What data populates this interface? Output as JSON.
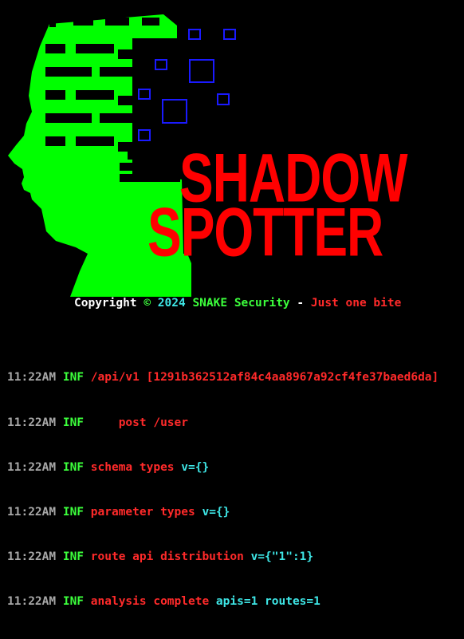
{
  "logo": {
    "title_line1": "SHADOW",
    "title_line2": "SPOTTER",
    "head_color": "#00ff00",
    "title_color": "#ff0000",
    "square_color": "#0000ff"
  },
  "copyright": {
    "label": "Copyright",
    "symbol": "©",
    "year": "2024",
    "org": "SNAKE Security",
    "dash": "-",
    "tagline": "Just one bite"
  },
  "logs": [
    {
      "time": "11:22AM",
      "level": "INF",
      "msg": "/api/v1 [1291b362512af84c4aa8967a92cf4fe37baed6da]",
      "kv": ""
    },
    {
      "time": "11:22AM",
      "level": "INF",
      "msg": "    post /user",
      "kv": ""
    },
    {
      "time": "11:22AM",
      "level": "INF",
      "msg": "schema types",
      "kv": "v={}"
    },
    {
      "time": "11:22AM",
      "level": "INF",
      "msg": "parameter types",
      "kv": "v={}"
    },
    {
      "time": "11:22AM",
      "level": "INF",
      "msg": "route api distribution",
      "kv": "v={\"1\":1}"
    },
    {
      "time": "11:22AM",
      "level": "INF",
      "msg": "analysis complete",
      "kv": "apis=1 routes=1"
    }
  ]
}
